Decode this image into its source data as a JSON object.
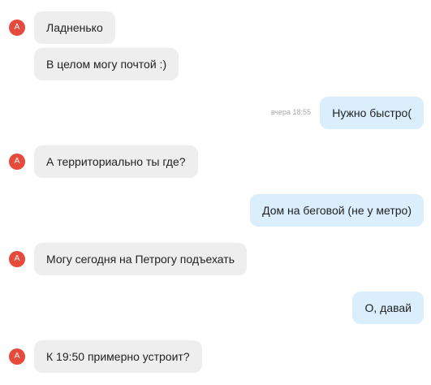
{
  "messages": [
    {
      "side": "in",
      "text": "Ладненько",
      "avatar": "A"
    },
    {
      "side": "in",
      "text": "В целом могу почтой :)"
    },
    {
      "side": "out",
      "text": "Нужно быстро(",
      "time": "вчера 18:55"
    },
    {
      "side": "in",
      "text": "А территориально ты где?",
      "avatar": "A"
    },
    {
      "side": "out",
      "text": "Дом на беговой (не у метро)"
    },
    {
      "side": "in",
      "text": "Могу сегодня на Петрогу подъехать",
      "avatar": "A"
    },
    {
      "side": "out",
      "text": "О, давай"
    },
    {
      "side": "in",
      "text": "К 19:50 примерно устроит?",
      "avatar": "A"
    }
  ],
  "colors": {
    "incoming_bubble": "#eeeeee",
    "outgoing_bubble": "#daeefb",
    "avatar": "#e64a3d"
  }
}
